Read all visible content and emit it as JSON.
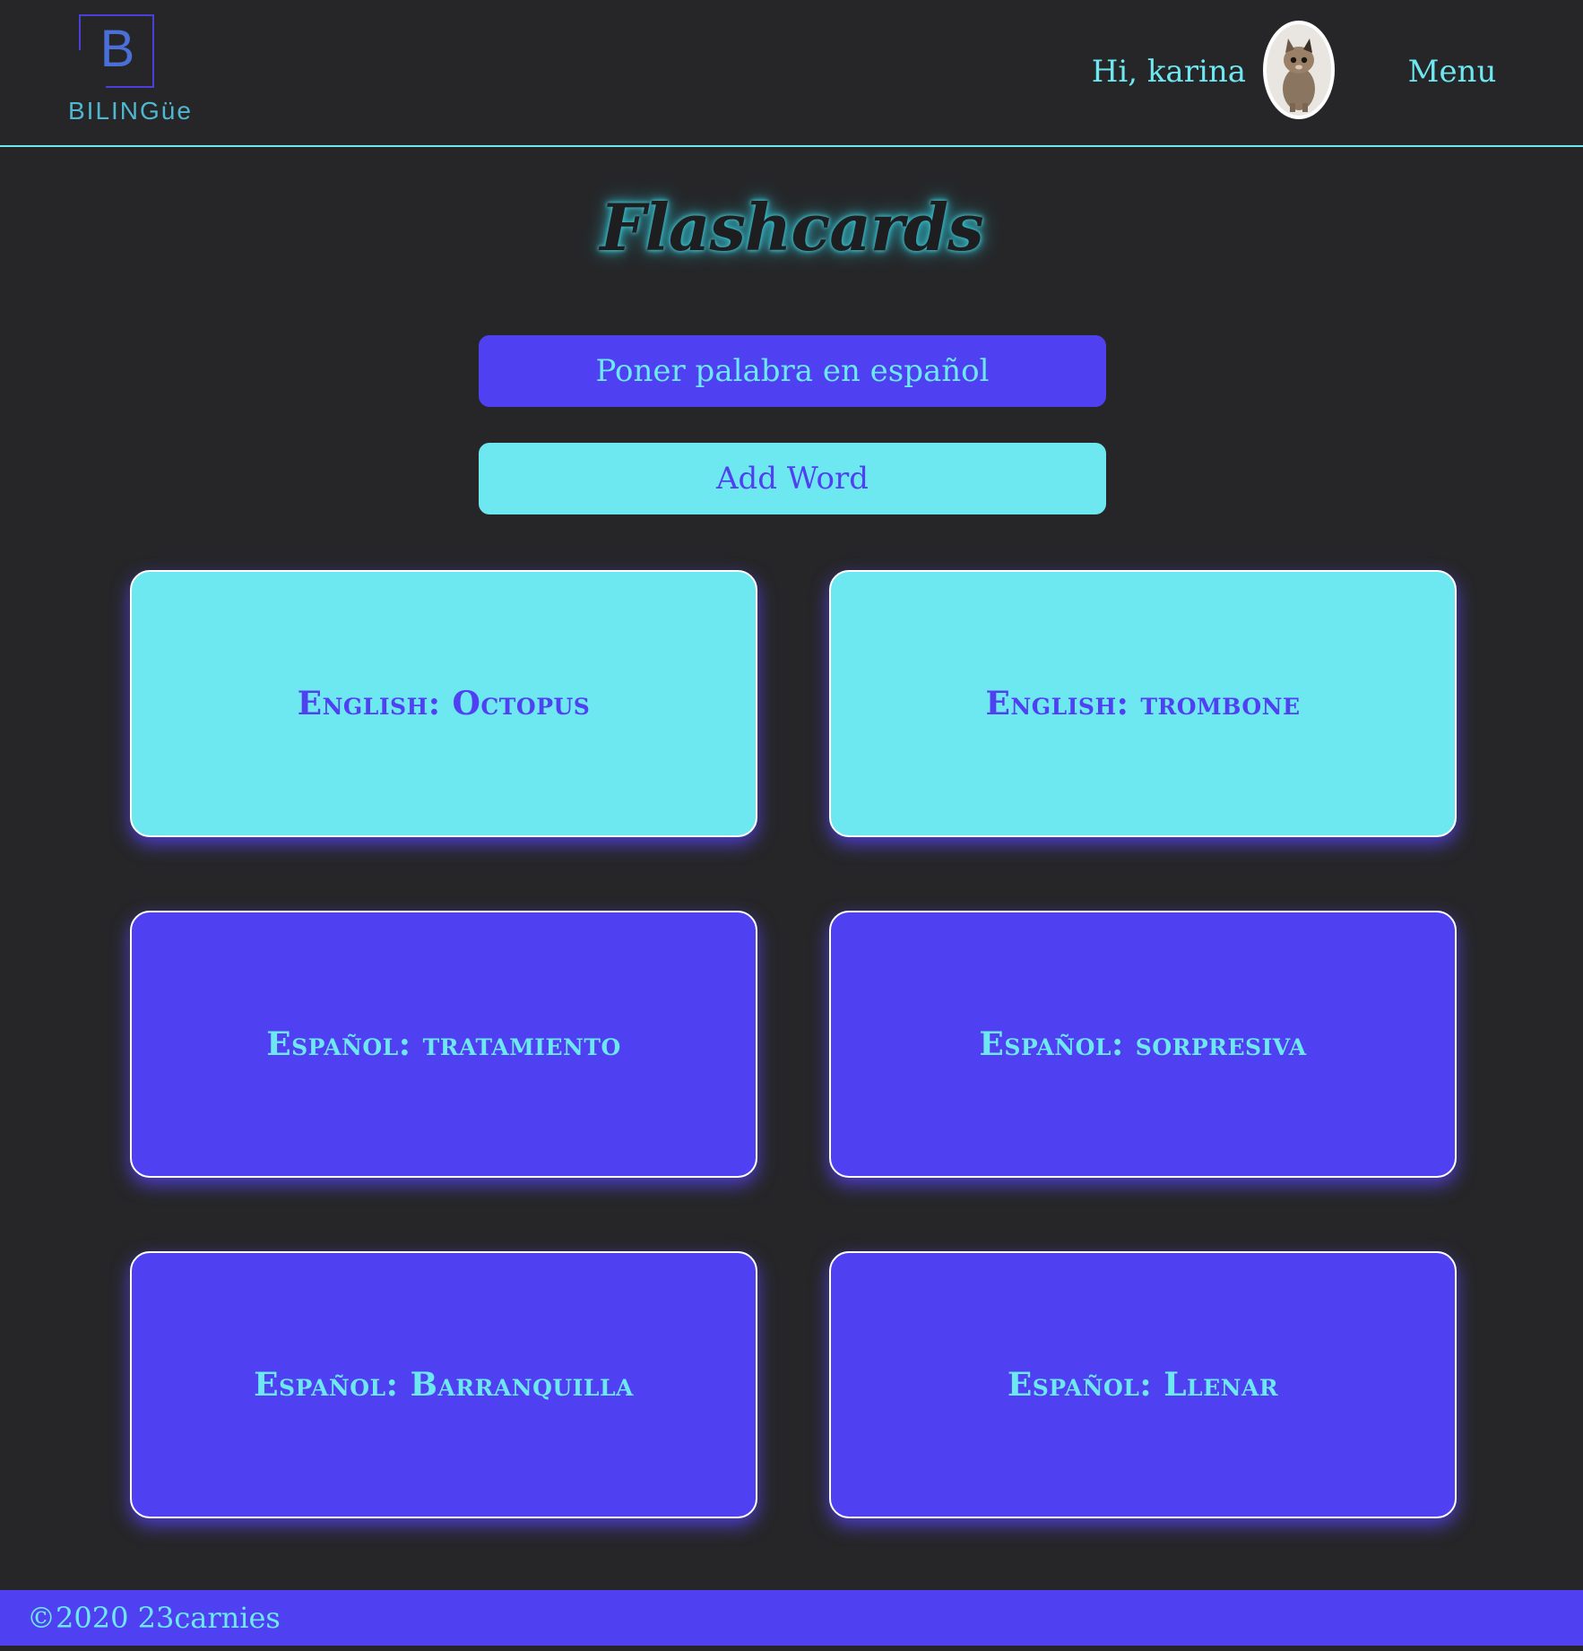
{
  "header": {
    "logo_letter": "B",
    "logo_text": "BILINGüe",
    "greeting": "Hi, karina",
    "menu_label": "Menu"
  },
  "main": {
    "title": "Flashcards",
    "spanish_button_label": "Poner palabra en español",
    "add_word_button_label": "Add Word",
    "cards": [
      {
        "label": "English: Octopus",
        "language": "english"
      },
      {
        "label": "English: trombone",
        "language": "english"
      },
      {
        "label": "Español: tratamiento",
        "language": "espanol"
      },
      {
        "label": "Español: sorpresiva",
        "language": "espanol"
      },
      {
        "label": "Español: Barranquilla",
        "language": "espanol"
      },
      {
        "label": "Español: Llenar",
        "language": "espanol"
      }
    ]
  },
  "footer": {
    "copyright": "©2020 23carnies"
  },
  "colors": {
    "background": "#262628",
    "accent_cyan": "#6ee8f0",
    "accent_purple": "#4f40f2"
  },
  "icons": {
    "avatar": "cat-photo-avatar"
  }
}
